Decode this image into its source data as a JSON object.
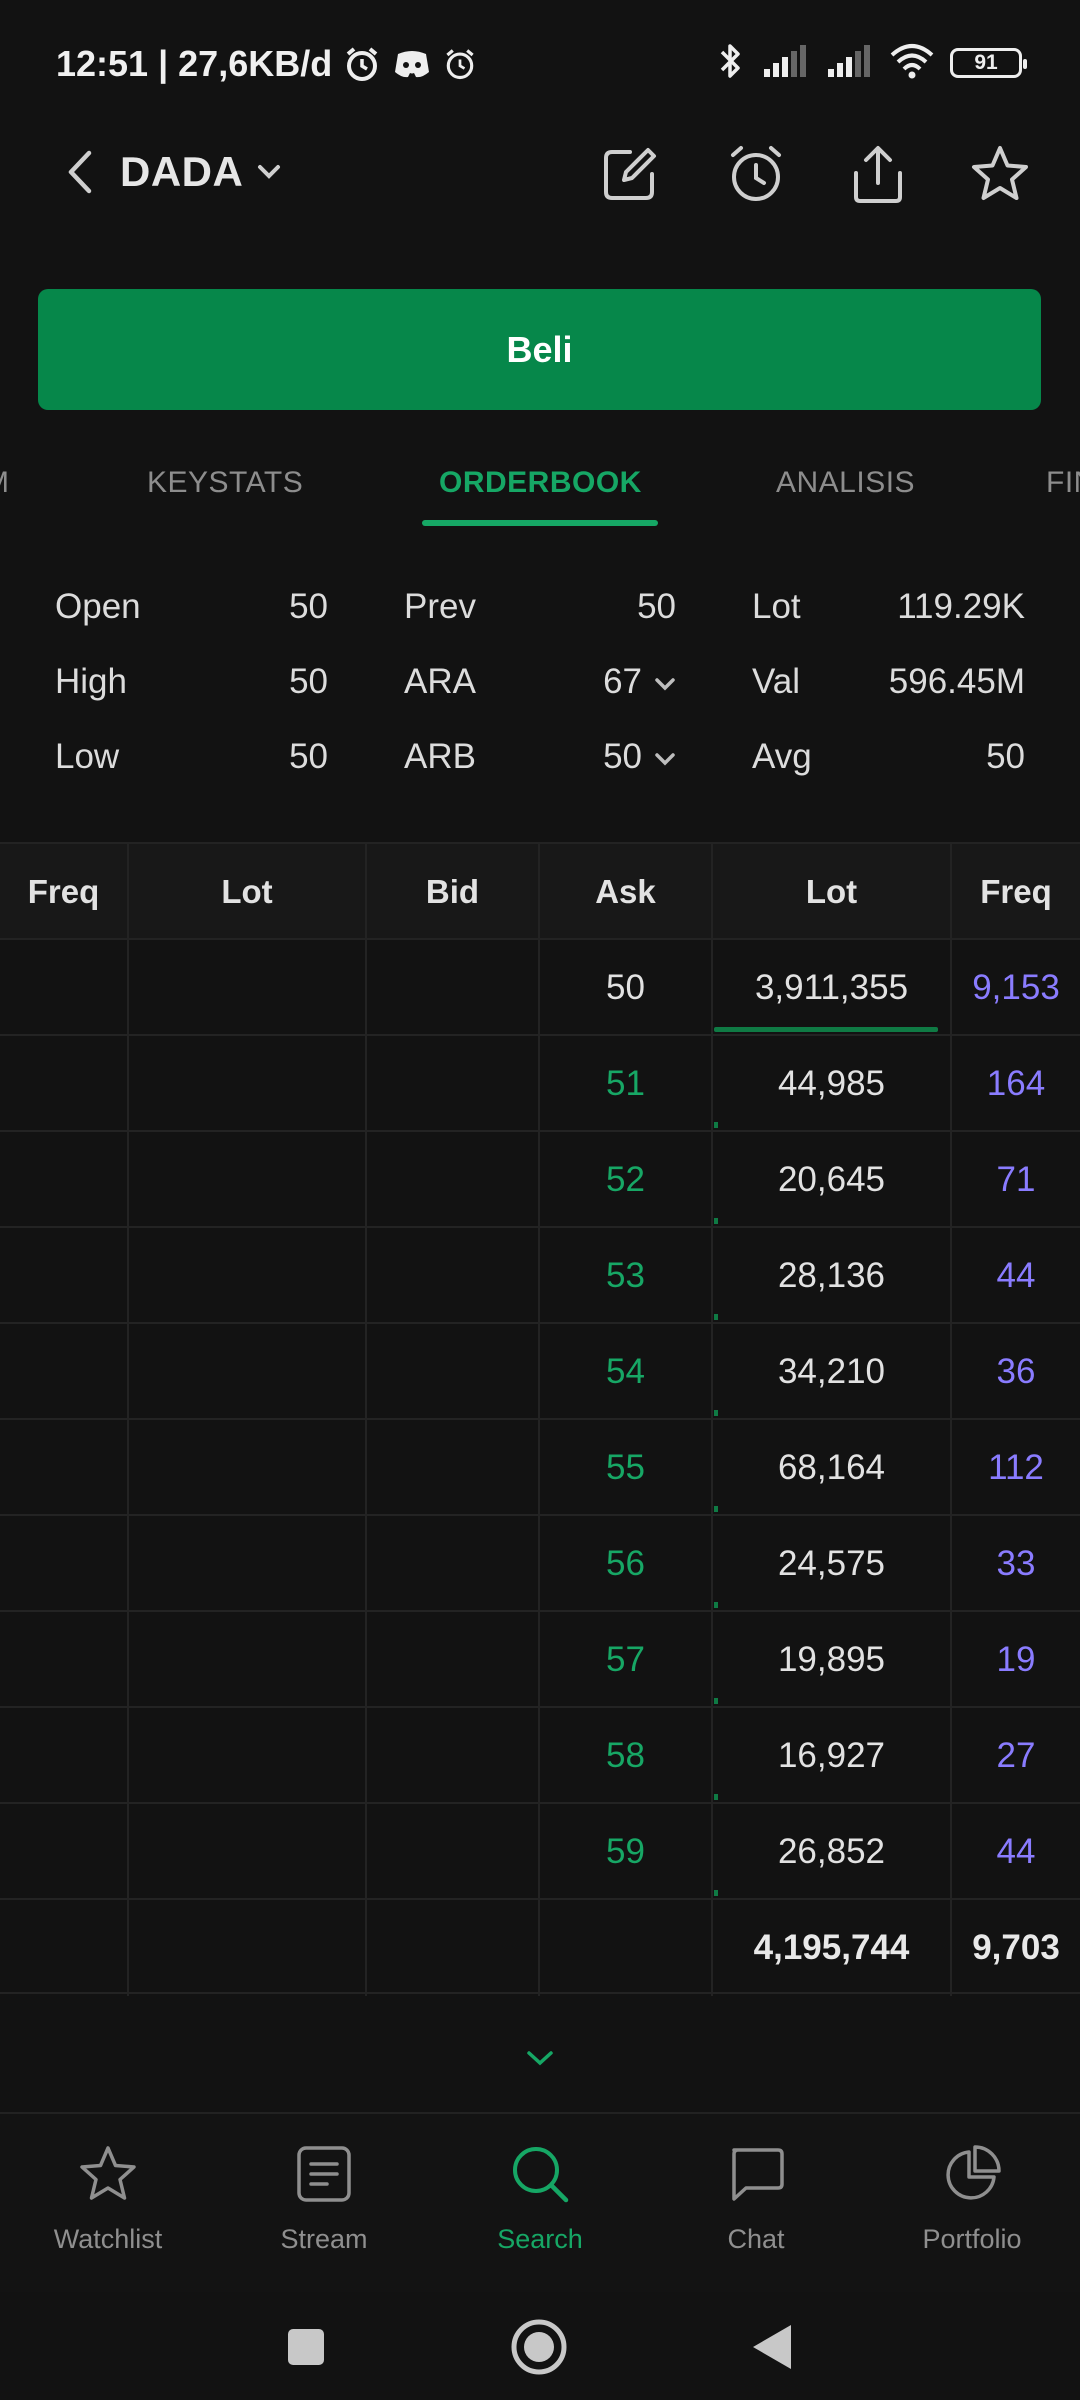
{
  "status_bar": {
    "time_and_speed": "12:51 | 27,6KB/d",
    "battery": "91",
    "icons": [
      "alarm-icon",
      "discord-icon",
      "alarm-icon",
      "bluetooth-icon",
      "signal-icon",
      "signal-icon",
      "wifi-icon",
      "battery-icon"
    ]
  },
  "header": {
    "ticker": "DADA",
    "icons": [
      "back-icon",
      "chevron-down-icon",
      "edit-icon",
      "alarm-icon",
      "share-icon",
      "star-icon"
    ]
  },
  "buy_button": {
    "label": "Beli"
  },
  "tabs": [
    {
      "label": "M"
    },
    {
      "label": "KEYSTATS"
    },
    {
      "label": "ORDERBOOK",
      "active": true
    },
    {
      "label": "ANALISIS"
    },
    {
      "label": "FIN"
    }
  ],
  "stats": {
    "open": {
      "label": "Open",
      "value": "50"
    },
    "high": {
      "label": "High",
      "value": "50"
    },
    "low": {
      "label": "Low",
      "value": "50"
    },
    "prev": {
      "label": "Prev",
      "value": "50"
    },
    "ara": {
      "label": "ARA",
      "value": "67"
    },
    "arb": {
      "label": "ARB",
      "value": "50"
    },
    "lot": {
      "label": "Lot",
      "value": "119.29K"
    },
    "val": {
      "label": "Val",
      "value": "596.45M"
    },
    "avg": {
      "label": "Avg",
      "value": "50"
    }
  },
  "orderbook": {
    "headers": [
      "Freq",
      "Lot",
      "Bid",
      "Ask",
      "Lot",
      "Freq"
    ],
    "rows": [
      {
        "ask": "50",
        "lot": "3,911,355",
        "freq": "9,153"
      },
      {
        "ask": "51",
        "lot": "44,985",
        "freq": "164"
      },
      {
        "ask": "52",
        "lot": "20,645",
        "freq": "71"
      },
      {
        "ask": "53",
        "lot": "28,136",
        "freq": "44"
      },
      {
        "ask": "54",
        "lot": "34,210",
        "freq": "36"
      },
      {
        "ask": "55",
        "lot": "68,164",
        "freq": "112"
      },
      {
        "ask": "56",
        "lot": "24,575",
        "freq": "33"
      },
      {
        "ask": "57",
        "lot": "19,895",
        "freq": "19"
      },
      {
        "ask": "58",
        "lot": "16,927",
        "freq": "27"
      },
      {
        "ask": "59",
        "lot": "26,852",
        "freq": "44"
      }
    ],
    "total": {
      "lot": "4,195,744",
      "freq": "9,703"
    }
  },
  "bottom_nav": [
    {
      "label": "Watchlist",
      "icon": "star-icon"
    },
    {
      "label": "Stream",
      "icon": "stream-icon"
    },
    {
      "label": "Search",
      "icon": "search-icon",
      "active": true
    },
    {
      "label": "Chat",
      "icon": "chat-icon"
    },
    {
      "label": "Portfolio",
      "icon": "pie-chart-icon"
    }
  ],
  "colors": {
    "background": "#121212",
    "accent": "#16a765",
    "buy_button": "#06874a",
    "freq": "#8a7cff",
    "text": "#d9d9d9"
  }
}
